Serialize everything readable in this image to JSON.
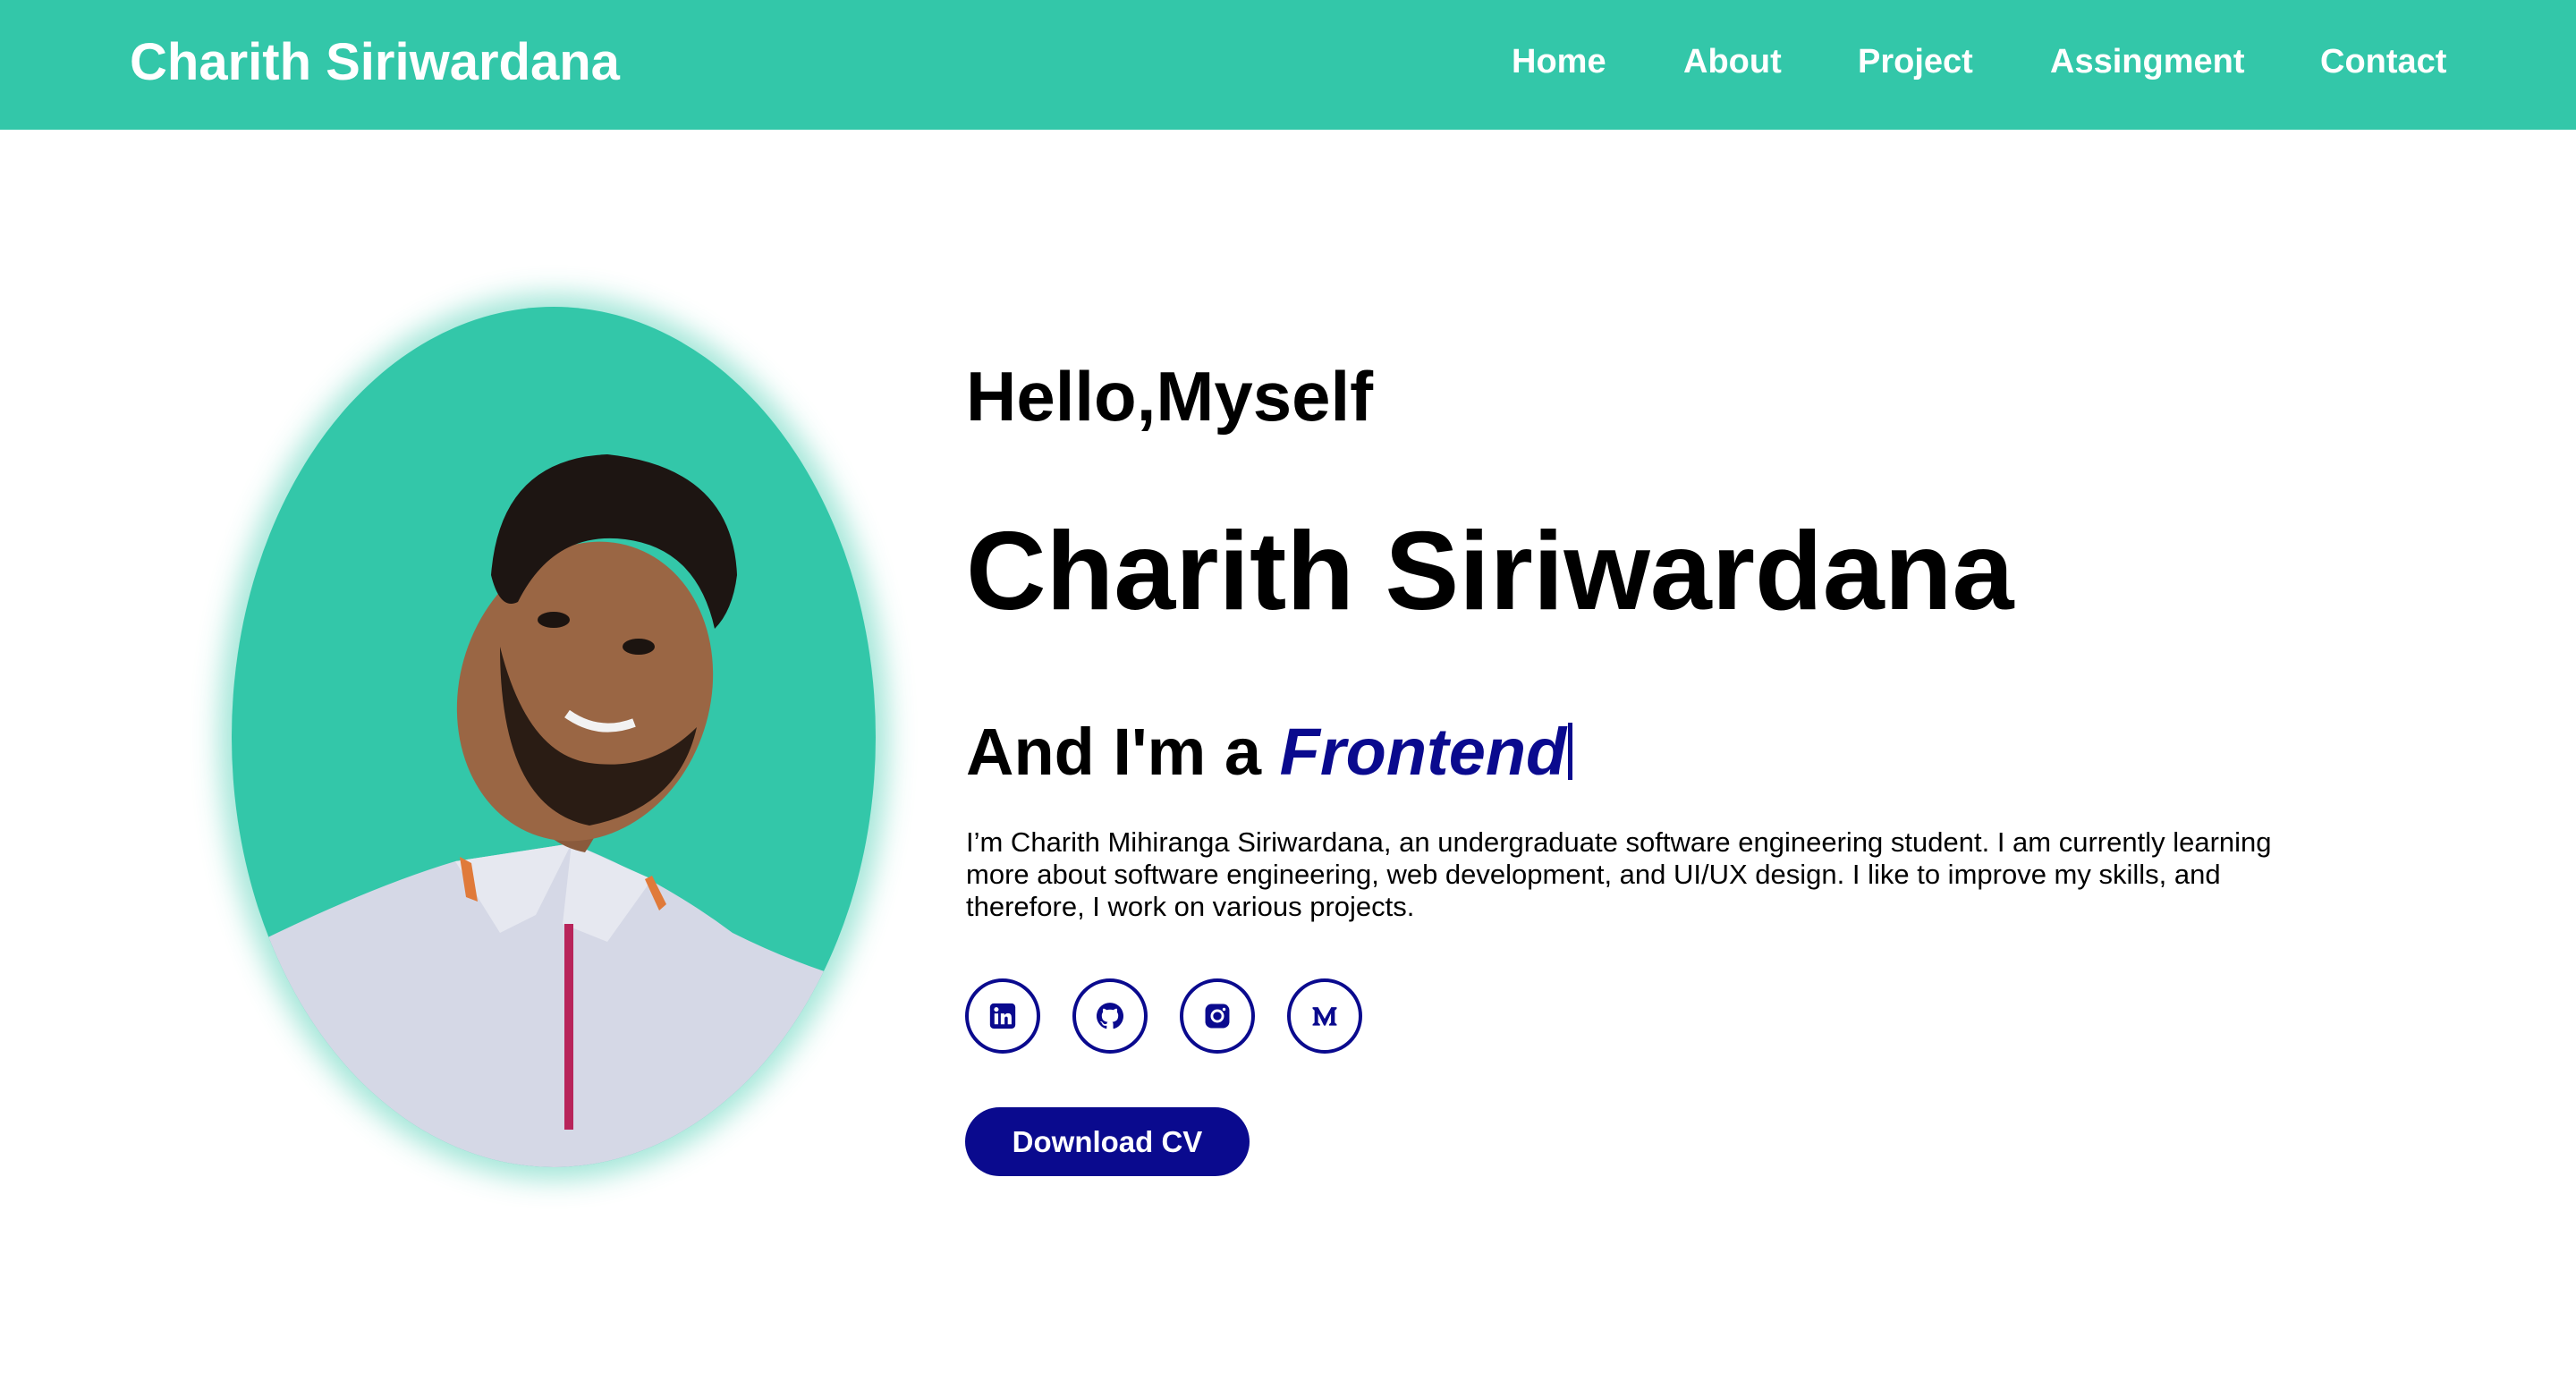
{
  "navbar": {
    "brand": "Charith Siriwardana",
    "links": [
      {
        "label": "Home"
      },
      {
        "label": "About"
      },
      {
        "label": "Project"
      },
      {
        "label": "Assingment"
      },
      {
        "label": "Contact"
      }
    ]
  },
  "hero": {
    "greeting": "Hello,Myself",
    "name": "Charith Siriwardana",
    "role_prefix": "And I'm a",
    "role_typed": "Frontend",
    "bio": "I’m Charith Mihiranga Siriwardana, an undergraduate software engineering student. I am currently learning more about software engineering, web development, and UI/UX design. I like to improve my skills, and therefore, I work on various projects.",
    "socials": [
      {
        "icon": "linkedin-icon"
      },
      {
        "icon": "github-icon"
      },
      {
        "icon": "instagram-icon"
      },
      {
        "icon": "medium-icon"
      }
    ],
    "download_label": "Download CV"
  },
  "colors": {
    "accent": "#33c7a9",
    "primary": "#0a0a8e",
    "text": "#000000",
    "background": "#ffffff"
  }
}
